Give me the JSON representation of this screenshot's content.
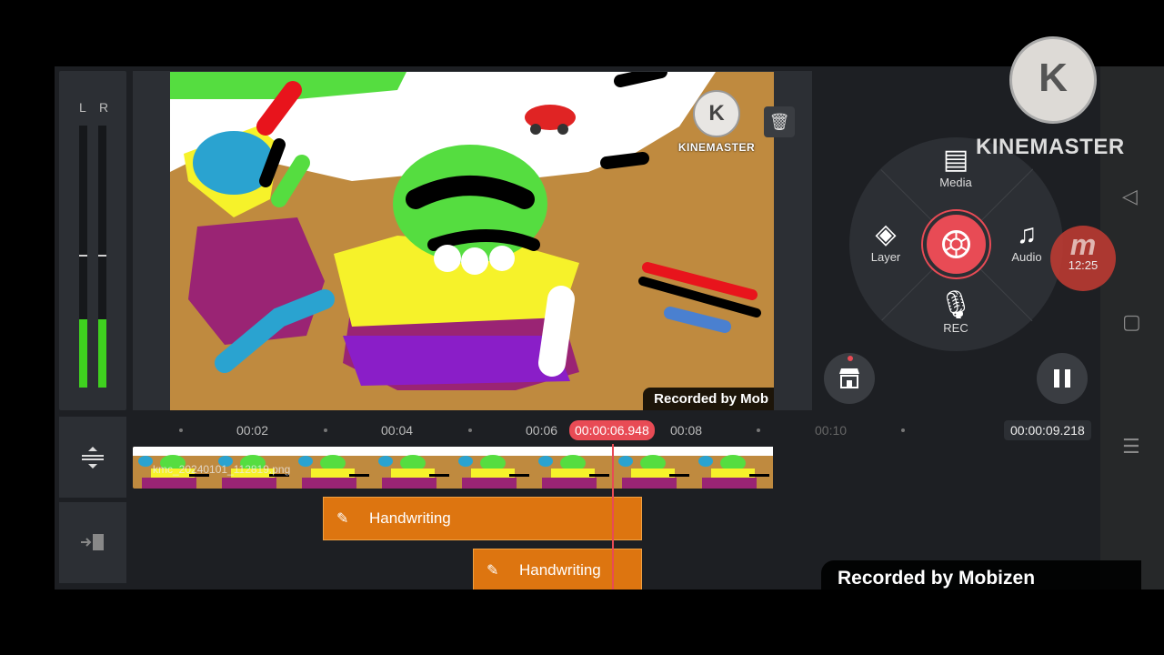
{
  "meter": {
    "left_label": "L",
    "right_label": "R",
    "left_level": 0.26,
    "right_level": 0.26,
    "peak_level": 0.5
  },
  "preview": {
    "watermark_logo": "K",
    "watermark_text": "KINEMASTER",
    "recorded_by": "Recorded by Mob"
  },
  "wheel": {
    "media_label": "Media",
    "layer_label": "Layer",
    "audio_label": "Audio",
    "rec_label": "REC",
    "media_icon": "film-folder-icon",
    "layer_icon": "layers-icon",
    "audio_icon": "music-note-icon",
    "rec_icon": "microphone-icon"
  },
  "timeline": {
    "ticks": [
      "00:02",
      "00:04",
      "00:06",
      "00:08",
      "00:10"
    ],
    "current_time": "00:00:06.948",
    "total_time": "00:00:09.218",
    "clip_filename": "kmc_20240101_112819.png",
    "layers": [
      {
        "label": "Handwriting",
        "icon": "pen-icon"
      },
      {
        "label": "Handwriting",
        "icon": "pen-icon"
      }
    ]
  },
  "overlays": {
    "km_logo": "K",
    "km_brand": "KINEMASTER",
    "mobizen_time": "12:25",
    "mobizen_letter": "m",
    "recorded_by": "Recorded by Mobizen"
  },
  "colors": {
    "accent": "#e84b55",
    "layer": "#dd7510",
    "meter": "#3fd11f"
  }
}
